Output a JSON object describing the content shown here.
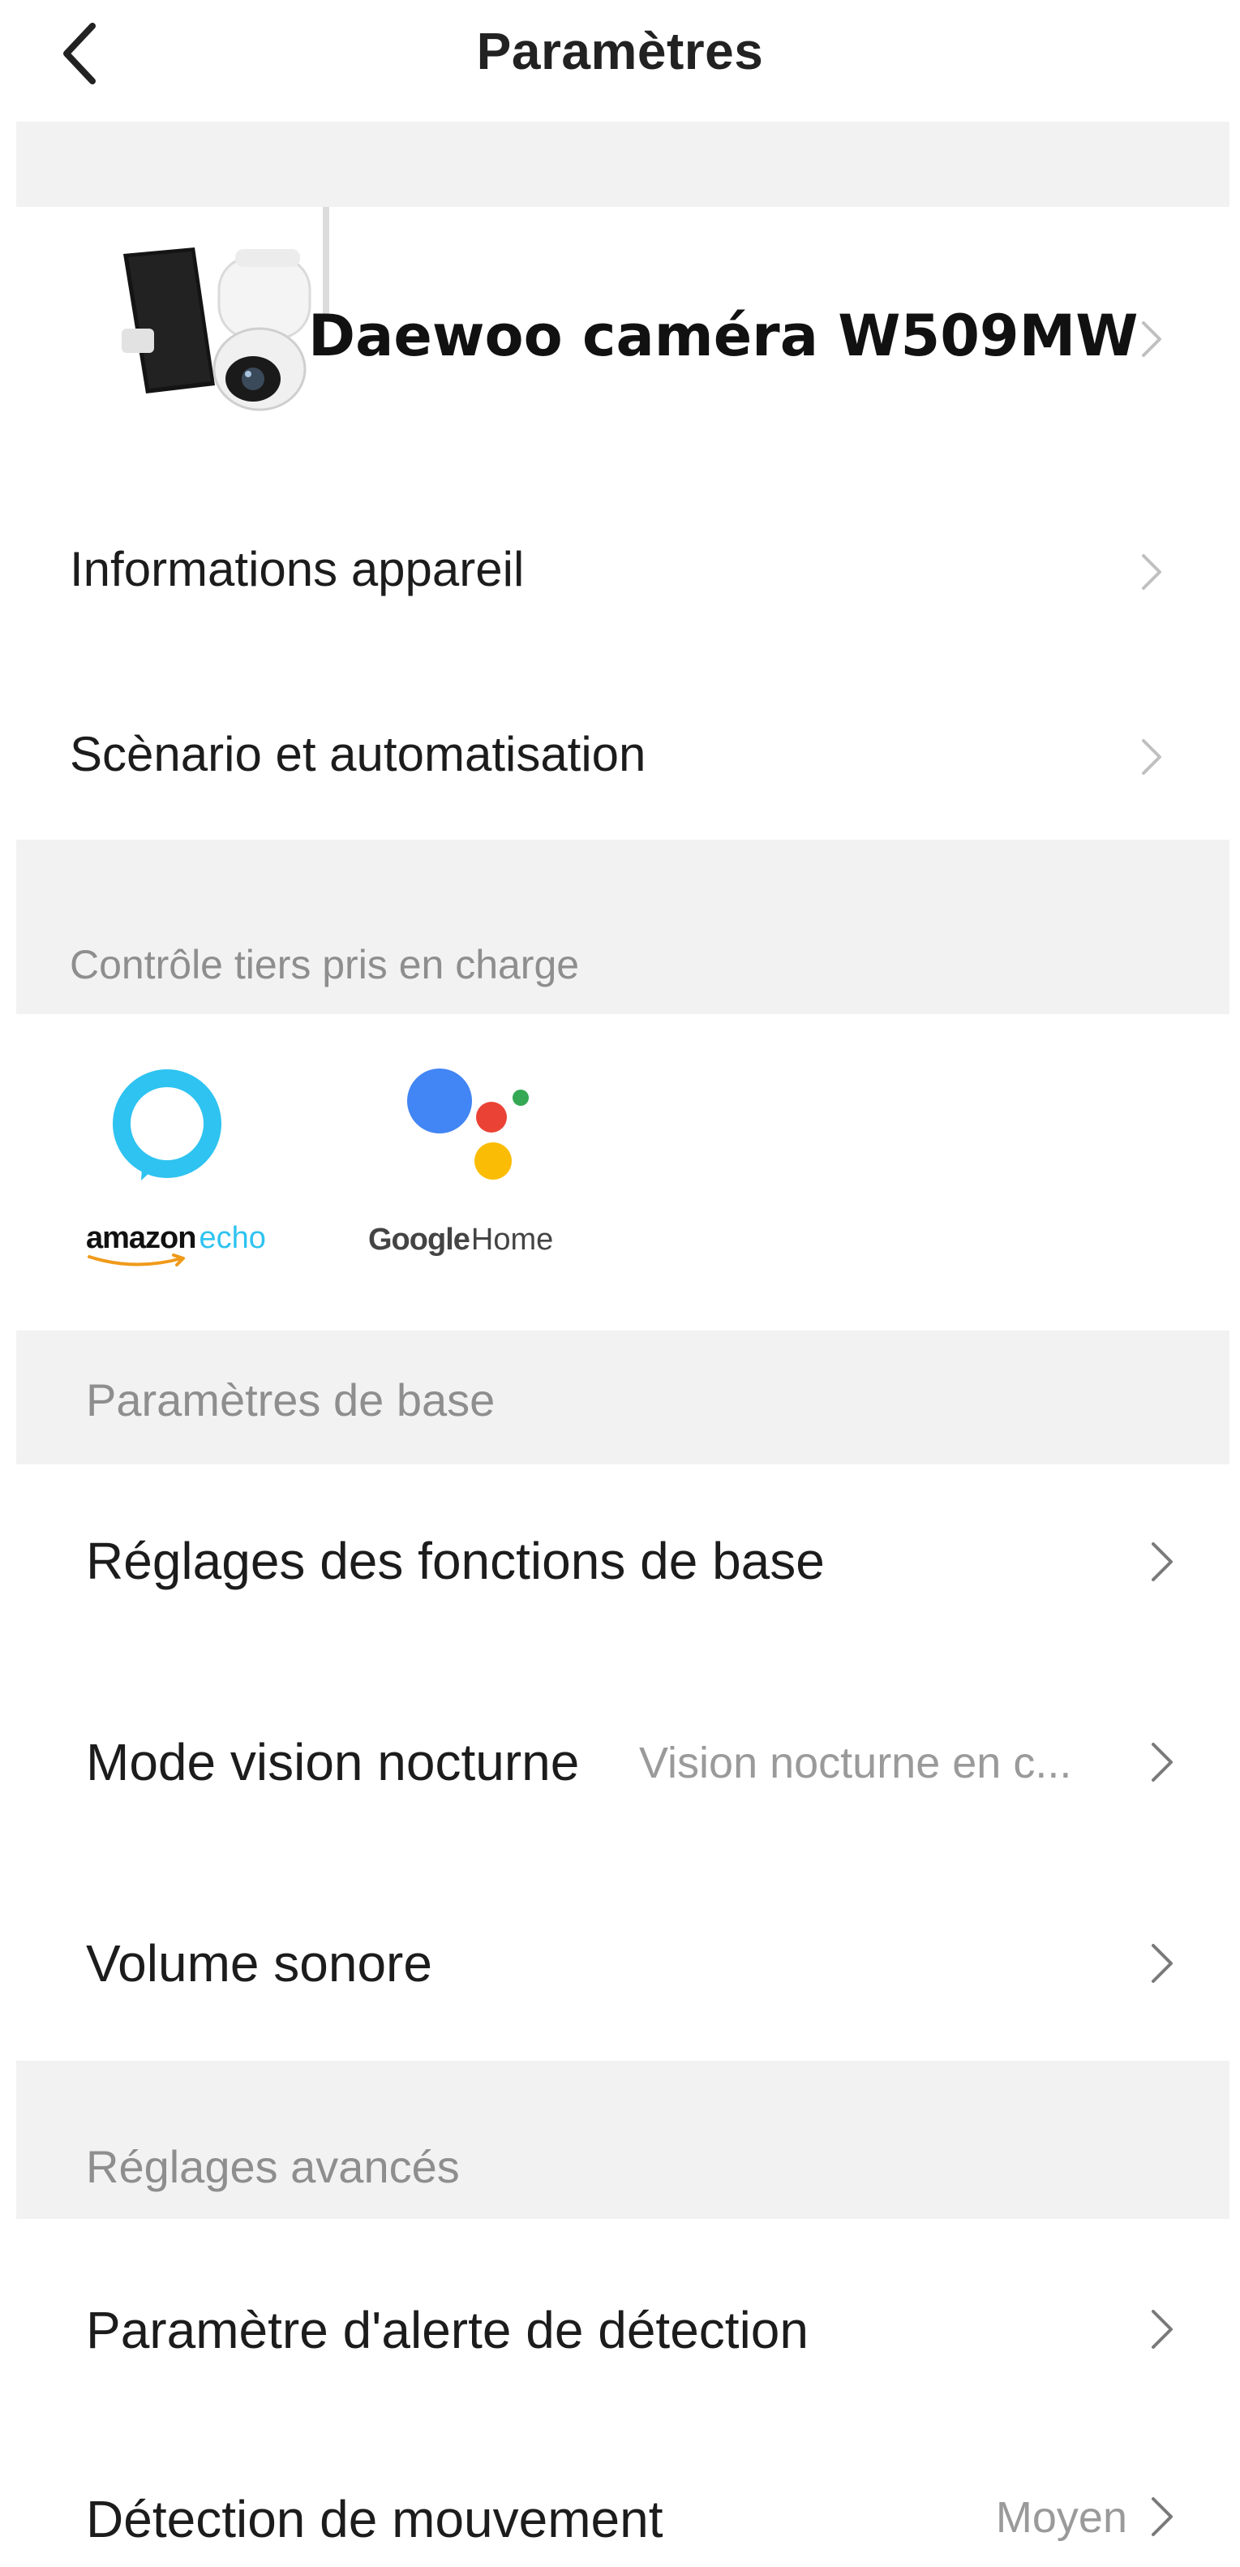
{
  "header": {
    "title": "Paramètres"
  },
  "device": {
    "name": "Daewoo caméra W509MW"
  },
  "menu_top": [
    {
      "label": "Informations appareil"
    },
    {
      "label": "Scènario et automatisation"
    }
  ],
  "third_party": {
    "section_label": "Contrôle tiers pris en charge",
    "amazon": {
      "word_amazon": "amazon",
      "word_echo": "echo"
    },
    "google": {
      "word_google": "Google",
      "word_home": "Home"
    }
  },
  "basic": {
    "section_label": "Paramètres de base",
    "items": [
      {
        "label": "Réglages des fonctions de base",
        "value": ""
      },
      {
        "label": "Mode vision nocturne",
        "value": "Vision nocturne en c..."
      },
      {
        "label": "Volume sonore",
        "value": ""
      }
    ]
  },
  "advanced": {
    "section_label": "Réglages avancés",
    "items": [
      {
        "label": "Paramètre d'alerte de détection",
        "value": ""
      },
      {
        "label": "Détection de mouvement",
        "value": "Moyen"
      }
    ]
  },
  "colors": {
    "alexa_ring": "#2ec3f0",
    "google_blue": "#4285f4",
    "google_red": "#ea4335",
    "google_yellow": "#fbbc05",
    "google_green": "#34a853",
    "separator_gray": "#f2f2f2"
  }
}
